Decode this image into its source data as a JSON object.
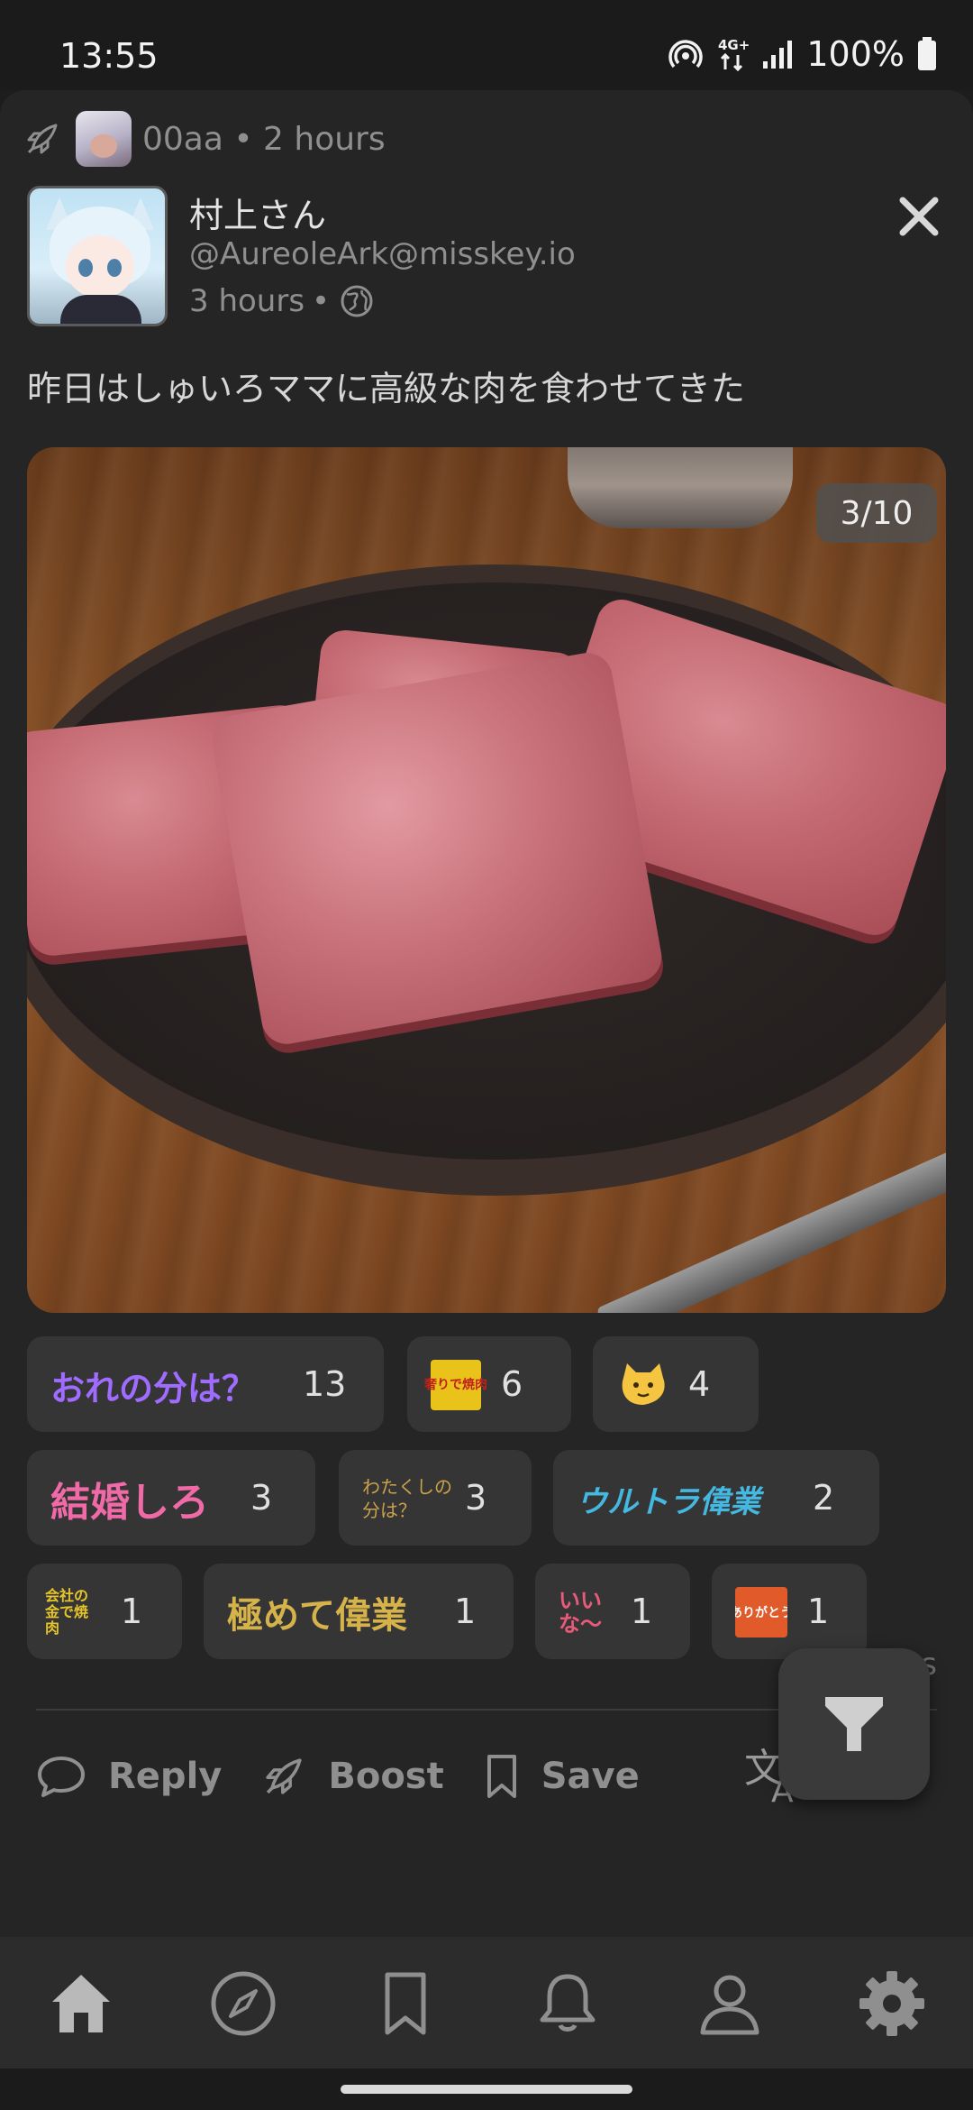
{
  "status_bar": {
    "time": "13:55",
    "battery_text": "100%",
    "network_label": "4G+"
  },
  "boost_header": {
    "text": "00aa • 2 hours"
  },
  "post": {
    "display_name": "村上さん",
    "handle": "@AureoleArk@misskey.io",
    "time": "3 hours",
    "separator": "•",
    "visibility_icon": "globe-icon",
    "text": "昨日はしゅいろママに高級な肉を食わせてきた",
    "media_counter": "3/10"
  },
  "reactions": [
    {
      "emoji_text": "おれの分は？",
      "count": "13",
      "color": "#8b5cf6"
    },
    {
      "emoji_text": "奢りで焼肉",
      "count": "6",
      "color": "#e0c020"
    },
    {
      "emoji_text": "cat-face",
      "count": "4",
      "color": "#f5c542"
    },
    {
      "emoji_text": "結婚しろ",
      "count": "3",
      "color": "#ec5fa0"
    },
    {
      "emoji_text": "わたくしの分は？",
      "count": "3",
      "color": "#c9a24a"
    },
    {
      "emoji_text": "ウルトラ偉業",
      "count": "2",
      "color": "#44b8e0"
    },
    {
      "emoji_text": "会社の金で焼肉",
      "count": "1",
      "color": "#e0c020"
    },
    {
      "emoji_text": "極めて偉業",
      "count": "1",
      "color": "#d6b24a"
    },
    {
      "emoji_text": "いいな〜",
      "count": "1",
      "color": "#e85a7a"
    },
    {
      "emoji_text": "ありがとう",
      "count": "1",
      "color": "#e05a2a"
    }
  ],
  "stats_text": "1  ts",
  "actions": {
    "reply": "Reply",
    "boost": "Boost",
    "save": "Save"
  },
  "nav": {
    "items": [
      "home-icon",
      "explore-icon",
      "bookmarks-icon",
      "notifications-icon",
      "profile-icon",
      "settings-icon"
    ]
  },
  "colors": {
    "background": "#1d1d1d",
    "card": "#252525",
    "reaction_chip": "#353535",
    "muted_text": "#8f8f8f",
    "nav_background": "#2c2c2c"
  }
}
